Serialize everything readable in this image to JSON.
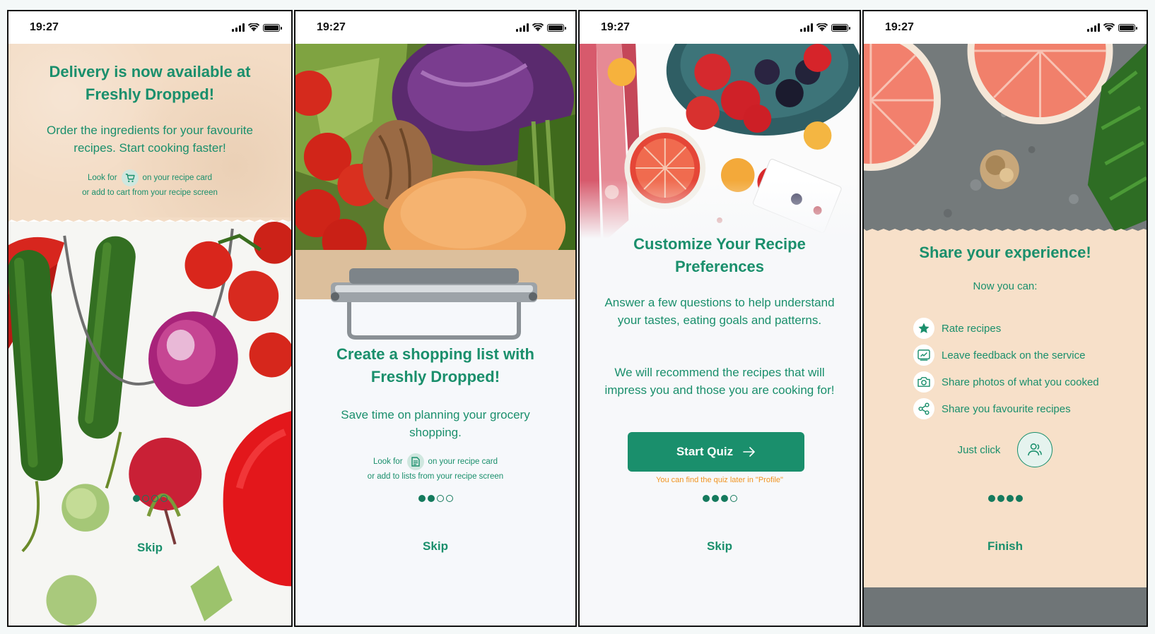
{
  "status_time": "19:27",
  "colors": {
    "primary": "#1a8f6c",
    "accent_orange": "#f0931f",
    "kraft": "#f3dcc5"
  },
  "screens": [
    {
      "title": "Delivery is now available at Freshly Dropped!",
      "body": "Order the ingredients for your favourite recipes. Start cooking faster!",
      "hint_prefix": "Look for",
      "hint_icon": "cart-icon",
      "hint_suffix": "on your recipe card",
      "hint_line2": "or add to cart from your recipe screen",
      "page": 1,
      "pages": 4,
      "action": "Skip"
    },
    {
      "title": "Create a shopping list with Freshly Dropped!",
      "body": "Save time on planning your grocery shopping.",
      "hint_prefix": "Look for",
      "hint_icon": "list-icon",
      "hint_suffix": "on your recipe card",
      "hint_line2": "or add to lists from your recipe screen",
      "page": 2,
      "pages": 4,
      "action": "Skip"
    },
    {
      "title": "Customize Your Recipe Preferences",
      "body": "Answer a few questions to help understand your tastes, eating goals and patterns.",
      "body2": "We will recommend the recipes that will impress you and those you are cooking for!",
      "button": "Start Quiz",
      "note": "You can find the quiz later in \"Profile\"",
      "page": 3,
      "pages": 4,
      "action": "Skip"
    },
    {
      "title": "Share your experience!",
      "subtitle": "Now you can:",
      "features": [
        {
          "icon": "star-icon",
          "label": "Rate recipes"
        },
        {
          "icon": "feedback-icon",
          "label": "Leave feedback on the service"
        },
        {
          "icon": "camera-icon",
          "label": "Share photos of what you cooked"
        },
        {
          "icon": "share-icon",
          "label": "Share you favourite recipes"
        }
      ],
      "just_click": "Just click",
      "just_click_icon": "users-icon",
      "page": 4,
      "pages": 4,
      "action": "Finish"
    }
  ]
}
